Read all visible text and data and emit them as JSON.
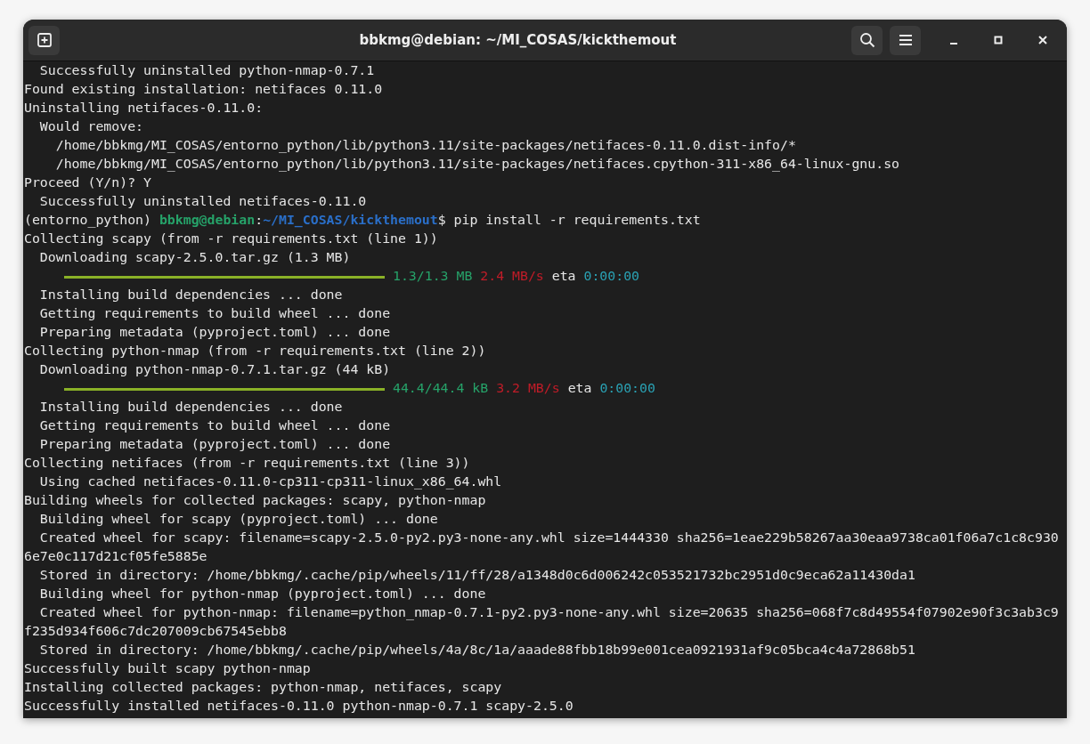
{
  "window": {
    "title": "bbkmg@debian: ~/MI_COSAS/kickthemout"
  },
  "lines": [
    {
      "kind": "text",
      "text": "  Successfully uninstalled python-nmap-0.7.1"
    },
    {
      "kind": "text",
      "text": "Found existing installation: netifaces 0.11.0"
    },
    {
      "kind": "text",
      "text": "Uninstalling netifaces-0.11.0:"
    },
    {
      "kind": "text",
      "text": "  Would remove:"
    },
    {
      "kind": "text",
      "text": "    /home/bbkmg/MI_COSAS/entorno_python/lib/python3.11/site-packages/netifaces-0.11.0.dist-info/*"
    },
    {
      "kind": "text",
      "text": "    /home/bbkmg/MI_COSAS/entorno_python/lib/python3.11/site-packages/netifaces.cpython-311-x86_64-linux-gnu.so"
    },
    {
      "kind": "text",
      "text": "Proceed (Y/n)? Y"
    },
    {
      "kind": "text",
      "text": "  Successfully uninstalled netifaces-0.11.0"
    },
    {
      "kind": "prompt",
      "env": "(entorno_python) ",
      "user": "bbkmg@debian",
      "sep": ":",
      "path": "~/MI_COSAS/kickthemout",
      "command": "$ pip install -r requirements.txt"
    },
    {
      "kind": "text",
      "text": "Collecting scapy (from -r requirements.txt (line 1))"
    },
    {
      "kind": "text",
      "text": "  Downloading scapy-2.5.0.tar.gz (1.3 MB)"
    },
    {
      "kind": "progress",
      "level": 1,
      "size": "1.3/1.3 MB",
      "speed": "2.4 MB/s",
      "eta_label": "eta",
      "eta": "0:00:00"
    },
    {
      "kind": "text",
      "text": "  Installing build dependencies ... done"
    },
    {
      "kind": "text",
      "text": "  Getting requirements to build wheel ... done"
    },
    {
      "kind": "text",
      "text": "  Preparing metadata (pyproject.toml) ... done"
    },
    {
      "kind": "text",
      "text": "Collecting python-nmap (from -r requirements.txt (line 2))"
    },
    {
      "kind": "text",
      "text": "  Downloading python-nmap-0.7.1.tar.gz (44 kB)"
    },
    {
      "kind": "progress",
      "level": 1,
      "size": "44.4/44.4 kB",
      "speed": "3.2 MB/s",
      "eta_label": "eta",
      "eta": "0:00:00"
    },
    {
      "kind": "text",
      "text": "  Installing build dependencies ... done"
    },
    {
      "kind": "text",
      "text": "  Getting requirements to build wheel ... done"
    },
    {
      "kind": "text",
      "text": "  Preparing metadata (pyproject.toml) ... done"
    },
    {
      "kind": "text",
      "text": "Collecting netifaces (from -r requirements.txt (line 3))"
    },
    {
      "kind": "text",
      "text": "  Using cached netifaces-0.11.0-cp311-cp311-linux_x86_64.whl"
    },
    {
      "kind": "text",
      "text": "Building wheels for collected packages: scapy, python-nmap"
    },
    {
      "kind": "text",
      "text": "  Building wheel for scapy (pyproject.toml) ... done"
    },
    {
      "kind": "text",
      "text": "  Created wheel for scapy: filename=scapy-2.5.0-py2.py3-none-any.whl size=1444330 sha256=1eae229b58267aa30eaa9738ca01f06a7c1c8c930"
    },
    {
      "kind": "text",
      "text": "6e7e0c117d21cf05fe5885e"
    },
    {
      "kind": "text",
      "text": "  Stored in directory: /home/bbkmg/.cache/pip/wheels/11/ff/28/a1348d0c6d006242c053521732bc2951d0c9eca62a11430da1"
    },
    {
      "kind": "text",
      "text": "  Building wheel for python-nmap (pyproject.toml) ... done"
    },
    {
      "kind": "text",
      "text": "  Created wheel for python-nmap: filename=python_nmap-0.7.1-py2.py3-none-any.whl size=20635 sha256=068f7c8d49554f07902e90f3c3ab3c9"
    },
    {
      "kind": "text",
      "text": "f235d934f606c7dc207009cb67545ebb8"
    },
    {
      "kind": "text",
      "text": "  Stored in directory: /home/bbkmg/.cache/pip/wheels/4a/8c/1a/aaade88fbb18b99e001cea0921931af9c05bca4c4a72868b51"
    },
    {
      "kind": "text",
      "text": "Successfully built scapy python-nmap"
    },
    {
      "kind": "text",
      "text": "Installing collected packages: python-nmap, netifaces, scapy"
    },
    {
      "kind": "text",
      "text": "Successfully installed netifaces-0.11.0 python-nmap-0.7.1 scapy-2.5.0"
    }
  ]
}
